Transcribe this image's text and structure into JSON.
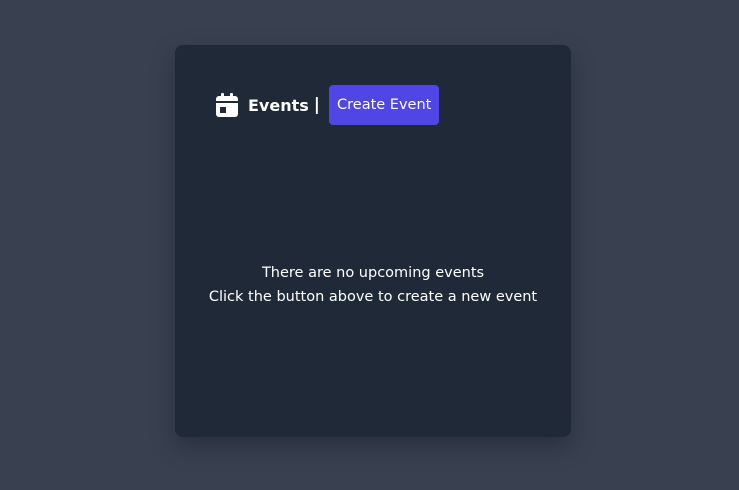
{
  "events": {
    "icon": "calendar-icon",
    "title": "Events",
    "separator": "|",
    "create_button_label": "Create Event"
  },
  "empty_state": {
    "line1": "There are no upcoming events",
    "line2": "Click the button above to create a new event"
  },
  "colors": {
    "background": "#394151",
    "card": "#1f2937",
    "accent": "#4f46e5",
    "text": "#ffffff"
  }
}
